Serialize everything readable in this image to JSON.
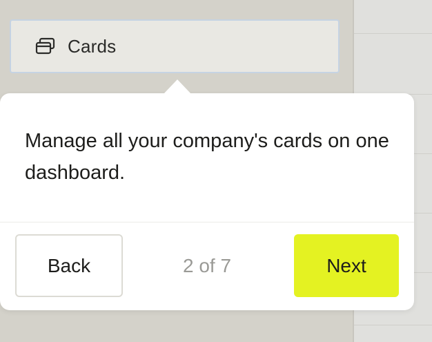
{
  "nav": {
    "highlighted_item": {
      "icon": "cards-icon",
      "label": "Cards"
    }
  },
  "tour": {
    "message": "Manage all your company's cards on one dashboard.",
    "back_label": "Back",
    "step_text": "2 of 7",
    "next_label": "Next"
  },
  "colors": {
    "next_button_bg": "#e4f222",
    "highlight_border": "#c5d3e3",
    "overlay_bg": "#d4d2ca"
  }
}
